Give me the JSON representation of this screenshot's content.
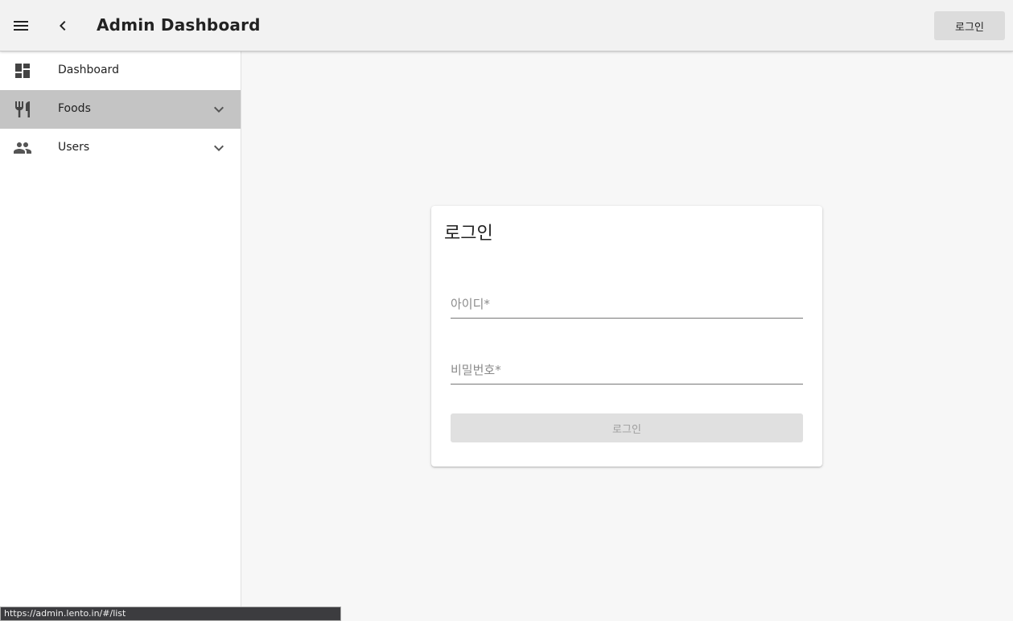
{
  "header": {
    "title": "Admin Dashboard",
    "login_button": "로그인",
    "menu_icon": "menu-icon",
    "back_icon": "chevron-left-icon"
  },
  "sidebar": {
    "items": [
      {
        "label": "Dashboard",
        "icon": "dashboard-icon",
        "expandable": false,
        "active": false
      },
      {
        "label": "Foods",
        "icon": "restaurant-icon",
        "expandable": true,
        "active": true
      },
      {
        "label": "Users",
        "icon": "people-icon",
        "expandable": true,
        "active": false
      }
    ]
  },
  "login_card": {
    "title": "로그인",
    "username_placeholder": "아이디*",
    "username_value": "",
    "password_placeholder": "비밀번호*",
    "password_value": "",
    "submit_label": "로그인"
  },
  "status_bar": {
    "url": "https://admin.lento.in/#/list"
  },
  "colors": {
    "active_item_bg": "#c4c4c4",
    "topbar_bg": "#f2f2f2",
    "disabled_button_bg": "#e0e0e0"
  }
}
